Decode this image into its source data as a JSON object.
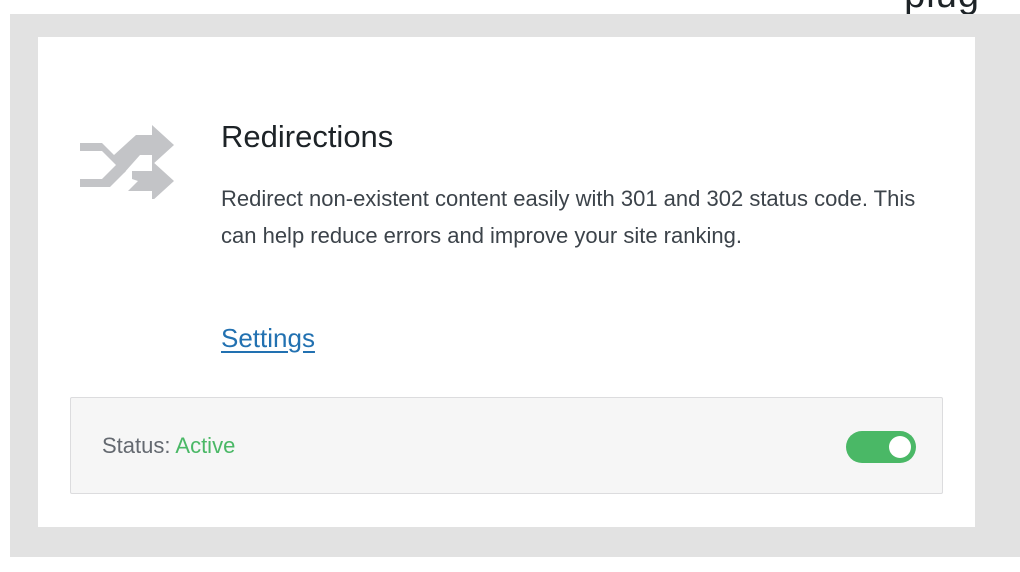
{
  "page": {
    "cutoff_heading": "plug"
  },
  "module": {
    "icon": "shuffle-arrows-icon",
    "title": "Redirections",
    "description": "Redirect non-existent content easily with 301 and 302 status code. This can help reduce errors and improve your site ranking.",
    "settings_label": "Settings",
    "status_label": "Status:",
    "status_value": "Active",
    "enabled": true
  },
  "colors": {
    "accent_link": "#2271b1",
    "active_green": "#4ab866",
    "icon_gray": "#c3c4c7",
    "card_bg": "#ffffff",
    "frame_bg": "#e2e2e2"
  }
}
